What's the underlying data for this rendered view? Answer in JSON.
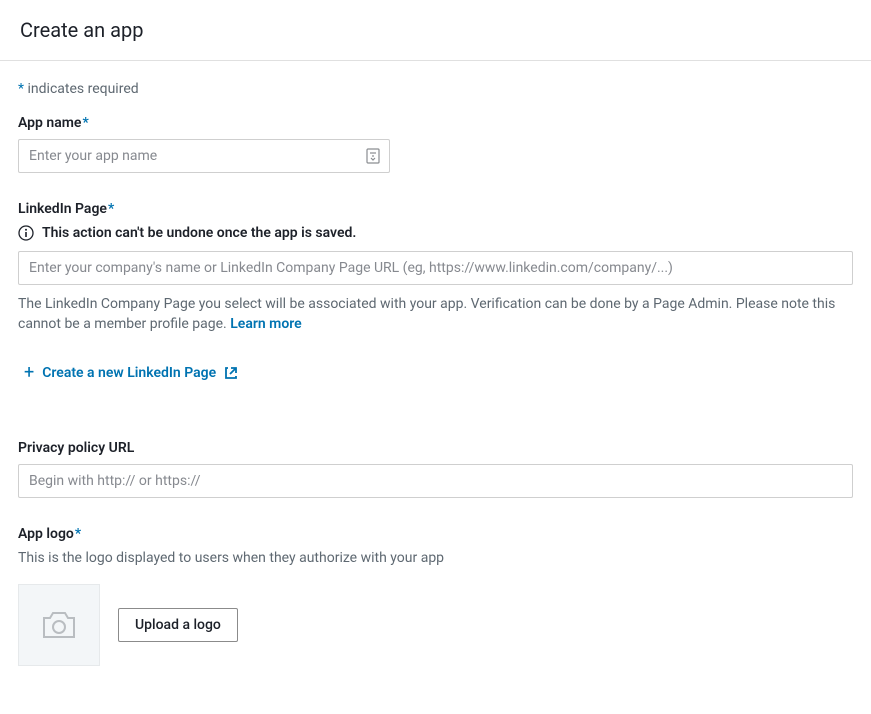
{
  "header": {
    "title": "Create an app"
  },
  "requiredNote": {
    "asterisk": "*",
    "text": " indicates required"
  },
  "appName": {
    "label": "App name",
    "placeholder": "Enter your app name"
  },
  "linkedinPage": {
    "label": "LinkedIn Page",
    "warning": "This action can't be undone once the app is saved.",
    "placeholder": "Enter your company's name or LinkedIn Company Page URL (eg, https://www.linkedin.com/company/...)",
    "helpText": "The LinkedIn Company Page you select will be associated with your app. Verification can be done by a Page Admin. Please note this cannot be a member profile page. ",
    "learnMore": "Learn more",
    "createLink": "Create a new LinkedIn Page"
  },
  "privacyPolicy": {
    "label": "Privacy policy URL",
    "placeholder": "Begin with http:// or https://"
  },
  "appLogo": {
    "label": "App logo",
    "helpText": "This is the logo displayed to users when they authorize with your app",
    "uploadButton": "Upload a logo"
  }
}
